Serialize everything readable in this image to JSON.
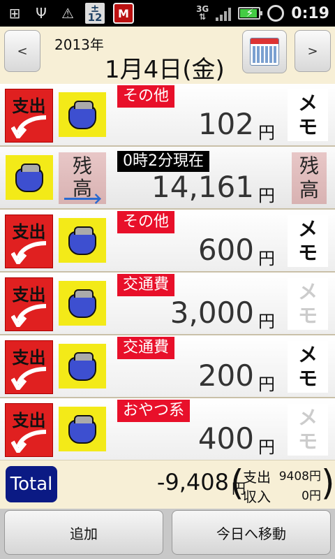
{
  "status_bar": {
    "calendar_icon_day": "12",
    "calendar_icon_sym": "±",
    "mcafee_letter": "M",
    "network": "3G",
    "time": "0:19"
  },
  "header": {
    "prev_label": "<",
    "next_label": ">",
    "year": "2013年",
    "date": "1月4日(金)"
  },
  "yen_suffix": "円",
  "expense_label": "支出",
  "balance_tag": [
    "残",
    "高"
  ],
  "memo_chars": [
    "メ",
    "モ"
  ],
  "balance_row": {
    "time_label": "0時2分現在",
    "amount": "14,161"
  },
  "entries": [
    {
      "category": "その他",
      "amount": "102",
      "memo_active": true
    },
    {
      "category": "その他",
      "amount": "600",
      "memo_active": true
    },
    {
      "category": "交通費",
      "amount": "3,000",
      "memo_active": false
    },
    {
      "category": "交通費",
      "amount": "200",
      "memo_active": true
    },
    {
      "category": "おやつ系",
      "amount": "400",
      "memo_active": false
    }
  ],
  "total": {
    "button_label": "Total",
    "amount": "-9,408",
    "paren_open": "(",
    "paren_close": ")",
    "expense_label": "支出",
    "expense_value": "9408円",
    "income_label": "収入",
    "income_value": "0円"
  },
  "bottom": {
    "add_label": "追加",
    "today_label": "今日へ移動"
  },
  "colors": {
    "expense_red": "#e02020",
    "category_red": "#e8102a",
    "purse_yellow": "#f3ea18",
    "total_navy": "#0b1a84"
  }
}
